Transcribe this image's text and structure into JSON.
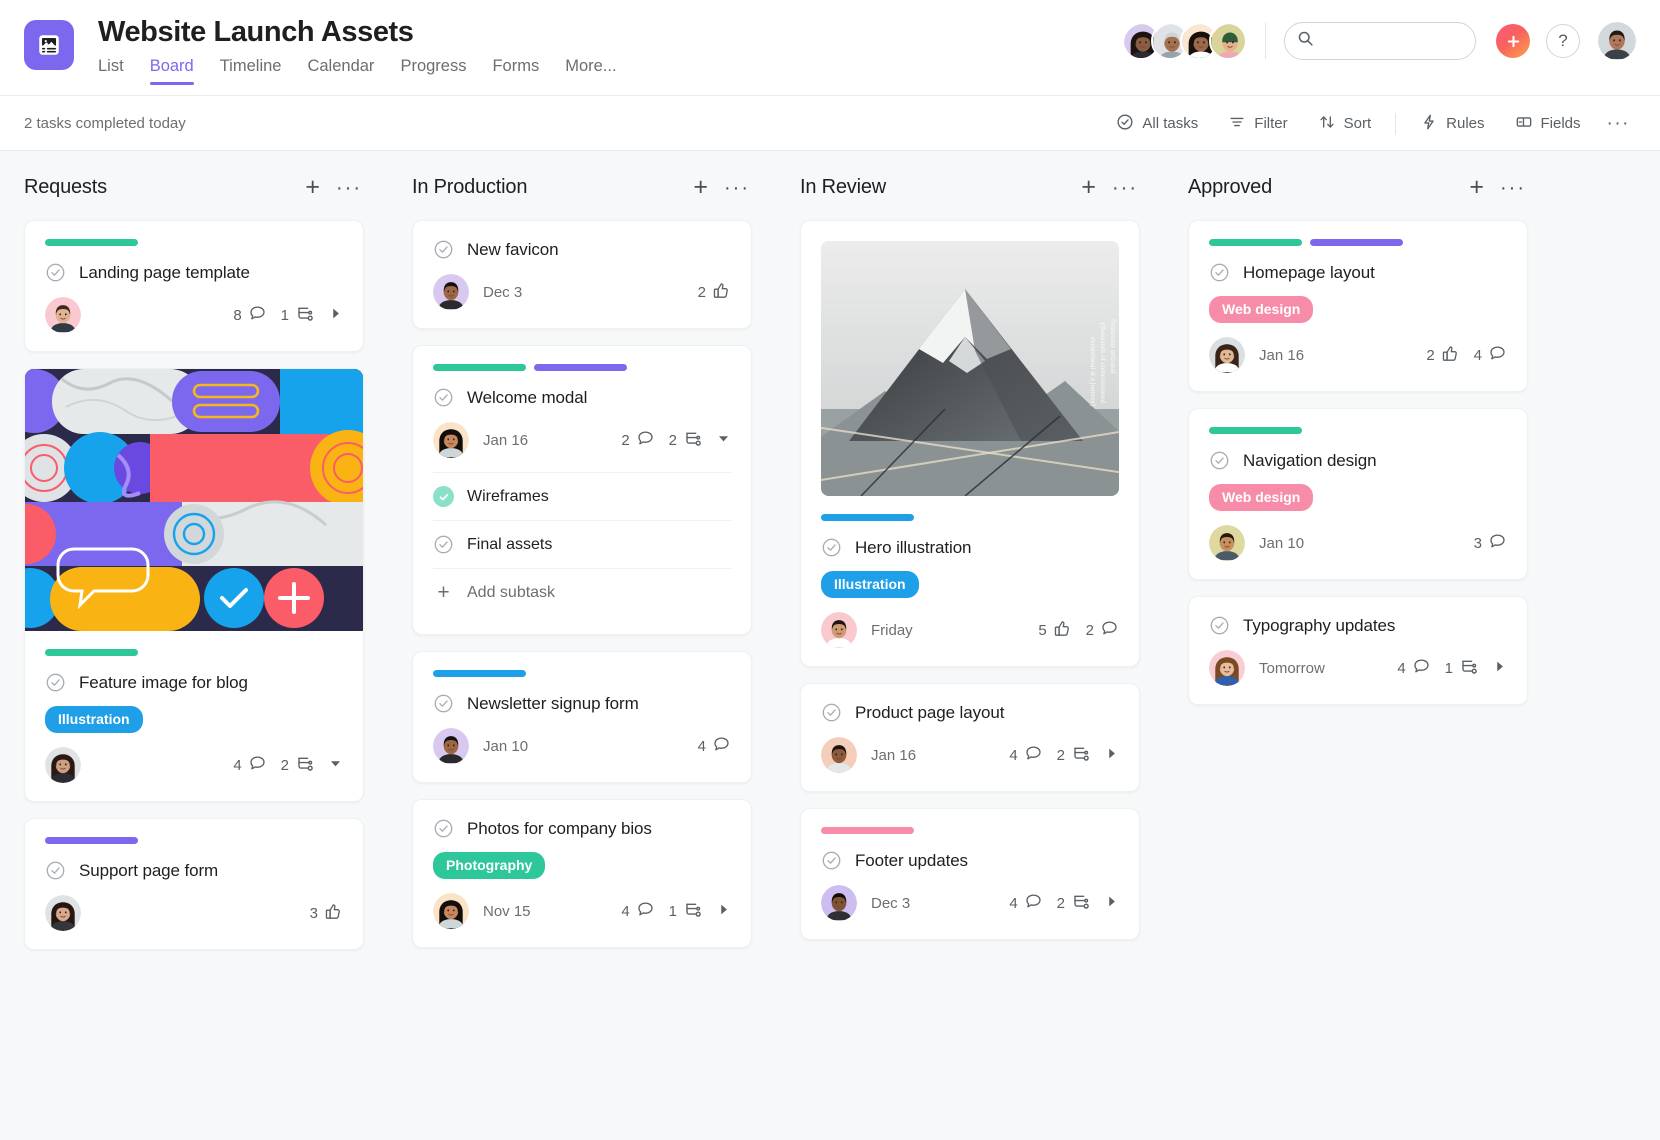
{
  "header": {
    "project_title": "Website Launch Assets",
    "project_icon": "image-list-icon",
    "tabs": [
      {
        "label": "List",
        "active": false
      },
      {
        "label": "Board",
        "active": true
      },
      {
        "label": "Timeline",
        "active": false
      },
      {
        "label": "Calendar",
        "active": false
      },
      {
        "label": "Progress",
        "active": false
      },
      {
        "label": "Forms",
        "active": false
      },
      {
        "label": "More...",
        "active": false
      }
    ],
    "search_placeholder": "",
    "search_value": "",
    "add_label": "+",
    "help_label": "?",
    "accent_color": "#7b68ee"
  },
  "toolbar": {
    "status_text": "2 tasks completed today",
    "items": [
      {
        "label": "All tasks",
        "icon": "check-circle-icon"
      },
      {
        "label": "Filter",
        "icon": "filter-icon"
      },
      {
        "label": "Sort",
        "icon": "sort-icon"
      },
      {
        "label": "Rules",
        "icon": "bolt-icon"
      },
      {
        "label": "Fields",
        "icon": "fields-icon"
      }
    ],
    "more_label": "···"
  },
  "colors": {
    "green": "#2dc79a",
    "purple": "#7b68ee",
    "blue": "#1f9fe8",
    "pink": "#f78ca8",
    "tag_blue": "#1f9fe8",
    "tag_green": "#2dc79a",
    "tag_pink": "#f78ca8"
  },
  "columns": [
    {
      "title": "Requests",
      "add_label": "+",
      "more_label": "···",
      "cards": [
        {
          "title": "Landing page template",
          "bars": [
            "green"
          ],
          "tag": null,
          "date": null,
          "avatar": "male-1",
          "meta": [
            {
              "value": "8",
              "icon": "comment-icon"
            },
            {
              "value": "1",
              "icon": "subtask-icon"
            }
          ],
          "expander": "caret-right"
        },
        {
          "title": "Feature image for blog",
          "media": "abstract-art",
          "bars": [
            "green"
          ],
          "tag": {
            "label": "Illustration",
            "color": "tag_blue"
          },
          "date": null,
          "avatar": "female-1",
          "meta": [
            {
              "value": "4",
              "icon": "comment-icon"
            },
            {
              "value": "2",
              "icon": "subtask-icon"
            }
          ],
          "expander": "caret-down"
        },
        {
          "title": "Support page form",
          "bars": [
            "purple"
          ],
          "tag": null,
          "date": null,
          "avatar": "female-2",
          "meta": [
            {
              "value": "3",
              "icon": "thumbsup-icon"
            }
          ],
          "expander": null
        }
      ]
    },
    {
      "title": "In Production",
      "add_label": "+",
      "more_label": "···",
      "cards": [
        {
          "title": "New favicon",
          "bars": [],
          "tag": null,
          "date": "Dec 3",
          "avatar": "male-2",
          "meta": [
            {
              "value": "2",
              "icon": "thumbsup-icon"
            }
          ],
          "expander": null
        },
        {
          "title": "Welcome modal",
          "bars": [
            "green",
            "purple"
          ],
          "tag": null,
          "date": "Jan 16",
          "avatar": "female-3",
          "meta": [
            {
              "value": "2",
              "icon": "comment-icon"
            },
            {
              "value": "2",
              "icon": "subtask-icon"
            }
          ],
          "expander": "caret-down",
          "subtasks": [
            {
              "label": "Wireframes",
              "done": true
            },
            {
              "label": "Final assets",
              "done": false
            }
          ],
          "add_subtask_label": "Add subtask"
        },
        {
          "title": "Newsletter signup form",
          "bars": [
            "blue"
          ],
          "tag": null,
          "date": "Jan 10",
          "avatar": "male-2",
          "meta": [
            {
              "value": "4",
              "icon": "comment-icon"
            }
          ],
          "expander": null
        },
        {
          "title": "Photos for company bios",
          "bars": [],
          "tag": {
            "label": "Photography",
            "color": "tag_green"
          },
          "date": "Nov 15",
          "avatar": "female-3",
          "meta": [
            {
              "value": "4",
              "icon": "comment-icon"
            },
            {
              "value": "1",
              "icon": "subtask-icon"
            }
          ],
          "expander": "caret-right"
        }
      ]
    },
    {
      "title": "In Review",
      "add_label": "+",
      "more_label": "···",
      "cards": [
        {
          "title": "Hero illustration",
          "media": "mountain-photo",
          "bars": [
            "blue"
          ],
          "tag": {
            "label": "Illustration",
            "color": "tag_blue"
          },
          "date": "Friday",
          "avatar": "male-3",
          "meta": [
            {
              "value": "5",
              "icon": "thumbsup-icon"
            },
            {
              "value": "2",
              "icon": "comment-icon"
            }
          ],
          "expander": null
        },
        {
          "title": "Product page layout",
          "bars": [],
          "tag": null,
          "date": "Jan 16",
          "avatar": "male-4",
          "meta": [
            {
              "value": "4",
              "icon": "comment-icon"
            },
            {
              "value": "2",
              "icon": "subtask-icon"
            }
          ],
          "expander": "caret-right"
        },
        {
          "title": "Footer updates",
          "bars": [
            "pink"
          ],
          "tag": null,
          "date": "Dec 3",
          "avatar": "male-5",
          "meta": [
            {
              "value": "4",
              "icon": "comment-icon"
            },
            {
              "value": "2",
              "icon": "subtask-icon"
            }
          ],
          "expander": "caret-right"
        }
      ]
    },
    {
      "title": "Approved",
      "add_label": "+",
      "more_label": "···",
      "cards": [
        {
          "title": "Homepage layout",
          "bars": [
            "green",
            "purple"
          ],
          "tag": {
            "label": "Web design",
            "color": "tag_pink"
          },
          "date": "Jan 16",
          "avatar": "female-4",
          "meta": [
            {
              "value": "2",
              "icon": "thumbsup-icon"
            },
            {
              "value": "4",
              "icon": "comment-icon"
            }
          ],
          "expander": null
        },
        {
          "title": "Navigation design",
          "bars": [
            "green"
          ],
          "tag": {
            "label": "Web design",
            "color": "tag_pink"
          },
          "date": "Jan 10",
          "avatar": "male-6",
          "meta": [
            {
              "value": "3",
              "icon": "comment-icon"
            }
          ],
          "expander": null
        },
        {
          "title": "Typography updates",
          "bars": [],
          "tag": null,
          "date": "Tomorrow",
          "avatar": "female-5",
          "meta": [
            {
              "value": "4",
              "icon": "comment-icon"
            },
            {
              "value": "1",
              "icon": "subtask-icon"
            }
          ],
          "expander": "caret-right"
        }
      ]
    }
  ]
}
